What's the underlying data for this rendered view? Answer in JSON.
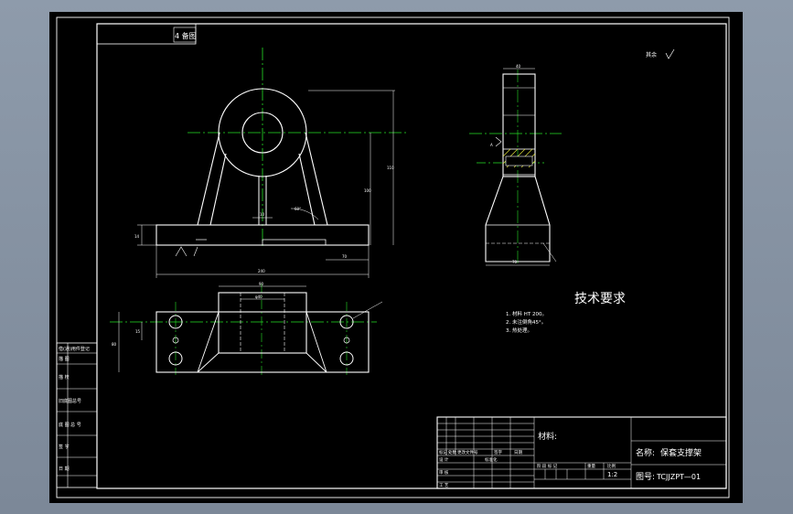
{
  "drawing": {
    "stamp": "4 备图",
    "roughness_note": "其余",
    "tech_title": "技术要求",
    "tech_notes": [
      "1. 材料 HT 200。",
      "2. 未注倒角45°。",
      "3. 热处理。"
    ]
  },
  "sidebar_labels": [
    "借(通)用件登记",
    "描 图",
    "描 校",
    "旧底图总号",
    "底 图 总 号",
    "签 字",
    "日 期"
  ],
  "title_block": {
    "material_label": "材料:",
    "name_label": "名称:",
    "name_value": "保套支撑架",
    "drawing_no_label": "图号:",
    "drawing_no_value": "TCJJZPT—01",
    "scale": "1:2",
    "revision_headers": [
      "标记",
      "处数",
      "更改文件号",
      "签字",
      "日期"
    ],
    "row_labels": [
      "设 计",
      "标准化",
      "审 核",
      "工 艺"
    ],
    "stage_labels": [
      "阶 段 标 记",
      "重量",
      "比例"
    ]
  }
}
